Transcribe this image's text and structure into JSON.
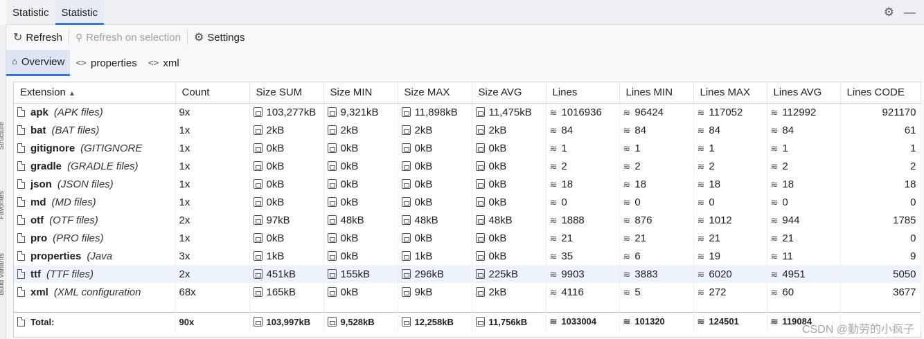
{
  "title_tabs": [
    "Statistic",
    "Statistic"
  ],
  "toolbar": {
    "refresh": "Refresh",
    "refresh_sel": "Refresh on selection",
    "settings": "Settings"
  },
  "subtabs": [
    "Overview",
    "properties",
    "xml"
  ],
  "side_labels": [
    "Structure",
    "Favorites",
    "Build Variants"
  ],
  "columns": [
    "Extension",
    "Count",
    "Size SUM",
    "Size MIN",
    "Size MAX",
    "Size AVG",
    "Lines",
    "Lines MIN",
    "Lines MAX",
    "Lines AVG",
    "Lines CODE"
  ],
  "rows": [
    {
      "ext": "apk",
      "desc": "(APK files)",
      "count": "9x",
      "size_sum": "103,277kB",
      "size_min": "9,321kB",
      "size_max": "11,898kB",
      "size_avg": "11,475kB",
      "lines": "1016936",
      "lines_min": "96424",
      "lines_max": "117052",
      "lines_avg": "112992",
      "lines_code": "921170"
    },
    {
      "ext": "bat",
      "desc": "(BAT files)",
      "count": "1x",
      "size_sum": "2kB",
      "size_min": "2kB",
      "size_max": "2kB",
      "size_avg": "2kB",
      "lines": "84",
      "lines_min": "84",
      "lines_max": "84",
      "lines_avg": "84",
      "lines_code": "61"
    },
    {
      "ext": "gitignore",
      "desc": "(GITIGNORE",
      "count": "1x",
      "size_sum": "0kB",
      "size_min": "0kB",
      "size_max": "0kB",
      "size_avg": "0kB",
      "lines": "1",
      "lines_min": "1",
      "lines_max": "1",
      "lines_avg": "1",
      "lines_code": "1"
    },
    {
      "ext": "gradle",
      "desc": "(GRADLE files)",
      "count": "1x",
      "size_sum": "0kB",
      "size_min": "0kB",
      "size_max": "0kB",
      "size_avg": "0kB",
      "lines": "2",
      "lines_min": "2",
      "lines_max": "2",
      "lines_avg": "2",
      "lines_code": "2"
    },
    {
      "ext": "json",
      "desc": "(JSON files)",
      "count": "1x",
      "size_sum": "0kB",
      "size_min": "0kB",
      "size_max": "0kB",
      "size_avg": "0kB",
      "lines": "18",
      "lines_min": "18",
      "lines_max": "18",
      "lines_avg": "18",
      "lines_code": "18"
    },
    {
      "ext": "md",
      "desc": "(MD files)",
      "count": "1x",
      "size_sum": "0kB",
      "size_min": "0kB",
      "size_max": "0kB",
      "size_avg": "0kB",
      "lines": "0",
      "lines_min": "0",
      "lines_max": "0",
      "lines_avg": "0",
      "lines_code": "0"
    },
    {
      "ext": "otf",
      "desc": "(OTF files)",
      "count": "2x",
      "size_sum": "97kB",
      "size_min": "48kB",
      "size_max": "48kB",
      "size_avg": "48kB",
      "lines": "1888",
      "lines_min": "876",
      "lines_max": "1012",
      "lines_avg": "944",
      "lines_code": "1785"
    },
    {
      "ext": "pro",
      "desc": "(PRO files)",
      "count": "1x",
      "size_sum": "0kB",
      "size_min": "0kB",
      "size_max": "0kB",
      "size_avg": "0kB",
      "lines": "21",
      "lines_min": "21",
      "lines_max": "21",
      "lines_avg": "21",
      "lines_code": "0"
    },
    {
      "ext": "properties",
      "desc": "(Java",
      "count": "3x",
      "size_sum": "1kB",
      "size_min": "0kB",
      "size_max": "1kB",
      "size_avg": "0kB",
      "lines": "35",
      "lines_min": "6",
      "lines_max": "19",
      "lines_avg": "11",
      "lines_code": "9"
    },
    {
      "ext": "ttf",
      "desc": "(TTF files)",
      "count": "2x",
      "size_sum": "451kB",
      "size_min": "155kB",
      "size_max": "296kB",
      "size_avg": "225kB",
      "lines": "9903",
      "lines_min": "3883",
      "lines_max": "6020",
      "lines_avg": "4951",
      "lines_code": "5050"
    },
    {
      "ext": "xml",
      "desc": "(XML configuration",
      "count": "68x",
      "size_sum": "165kB",
      "size_min": "0kB",
      "size_max": "9kB",
      "size_avg": "2kB",
      "lines": "4116",
      "lines_min": "5",
      "lines_max": "272",
      "lines_avg": "60",
      "lines_code": "3677"
    }
  ],
  "total": {
    "label": "Total:",
    "count": "90x",
    "size_sum": "103,997kB",
    "size_min": "9,528kB",
    "size_max": "12,258kB",
    "size_avg": "11,756kB",
    "lines": "1033004",
    "lines_min": "101320",
    "lines_max": "124501",
    "lines_avg": "119084"
  },
  "watermark": "CSDN @勤劳的小疯子",
  "selected_row": 9
}
